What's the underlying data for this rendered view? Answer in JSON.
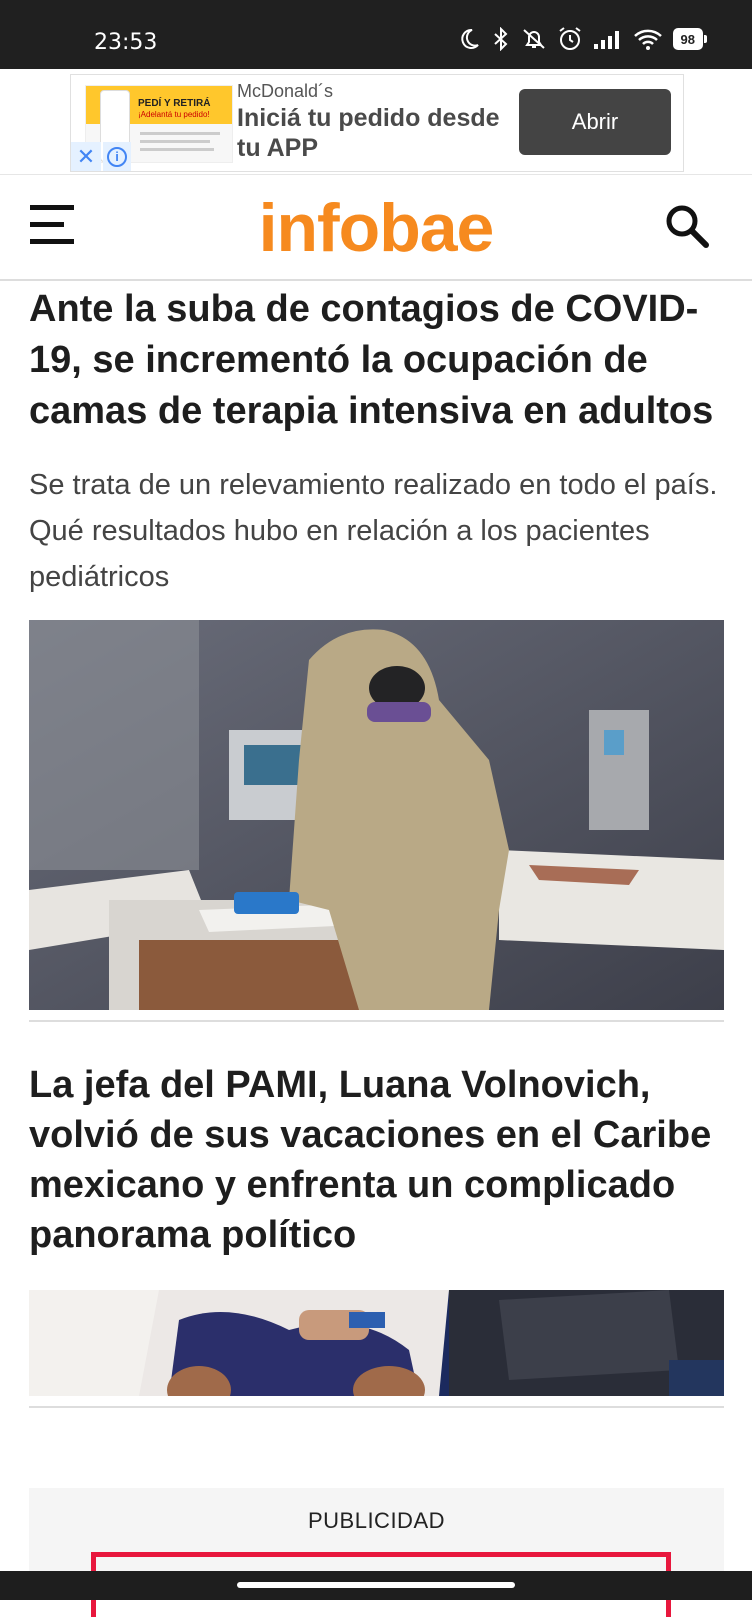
{
  "status_bar": {
    "time": "23:53",
    "battery": "98",
    "icons": [
      "moon-icon",
      "bluetooth-icon",
      "bell-muted-icon",
      "alarm-icon",
      "signal-icon",
      "wifi-icon",
      "battery-icon"
    ]
  },
  "ad_banner": {
    "thumb_headline": "PEDÍ Y RETIRÁ",
    "thumb_sub": "¡Adelantá tu pedido!",
    "advertiser": "McDonald´s",
    "title": "Iniciá tu pedido desde tu APP",
    "cta": "Abrir"
  },
  "header": {
    "logo": "infobae",
    "logo_color": "#f68a1f"
  },
  "articles": [
    {
      "title": "Ante la suba de contagios de COVID-19, se incrementó la ocupación de camas de terapia intensiva en adultos",
      "summary": "Se trata de un relevamiento realizado en todo el país. Qué resultados hubo en relación a los pacientes pediátricos"
    },
    {
      "title": "La jefa del PAMI, Luana Volnovich, volvió de sus vacaciones en el Caribe mexicano y enfrenta un complicado panorama político"
    }
  ],
  "advertising": {
    "label": "PUBLICIDAD"
  }
}
